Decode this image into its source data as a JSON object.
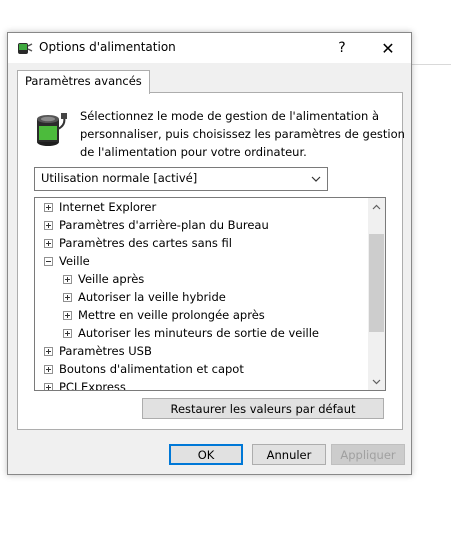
{
  "window": {
    "title": "Options d'alimentation",
    "help_label": "?",
    "close_label": "✕"
  },
  "tab": {
    "label": "Paramètres avancés"
  },
  "description": {
    "lines": [
      "Sélectionnez le mode de gestion de l'alimentation à",
      "personnaliser, puis choisissez les paramètres de gestion",
      "de l'alimentation pour votre ordinateur."
    ]
  },
  "plan_select": {
    "value": "Utilisation normale [activé]"
  },
  "tree": {
    "items": [
      {
        "label": "Internet Explorer",
        "expander": "plus",
        "level": 0
      },
      {
        "label": "Paramètres d'arrière-plan du Bureau",
        "expander": "plus",
        "level": 0
      },
      {
        "label": "Paramètres des cartes sans fil",
        "expander": "plus",
        "level": 0
      },
      {
        "label": "Veille",
        "expander": "minus",
        "level": 0
      },
      {
        "label": "Veille après",
        "expander": "plus",
        "level": 1
      },
      {
        "label": "Autoriser la veille hybride",
        "expander": "plus",
        "level": 1
      },
      {
        "label": "Mettre en veille prolongée après",
        "expander": "plus",
        "level": 1
      },
      {
        "label": "Autoriser les minuteurs de sortie de veille",
        "expander": "plus",
        "level": 1
      },
      {
        "label": "Paramètres USB",
        "expander": "plus",
        "level": 0
      },
      {
        "label": "Boutons d'alimentation et capot",
        "expander": "plus",
        "level": 0
      },
      {
        "label": "PCI Express",
        "expander": "plus",
        "level": 0
      }
    ]
  },
  "buttons": {
    "restore": "Restaurer les valeurs par défaut",
    "ok": "OK",
    "cancel": "Annuler",
    "apply": "Appliquer"
  },
  "icons": {
    "window_icon": "power-options-icon",
    "panel_icon": "battery-plug-icon"
  },
  "colors": {
    "dialog_bg": "#f0f0f0",
    "accent": "#0078d7",
    "disabled_text": "#a0a0a0"
  }
}
